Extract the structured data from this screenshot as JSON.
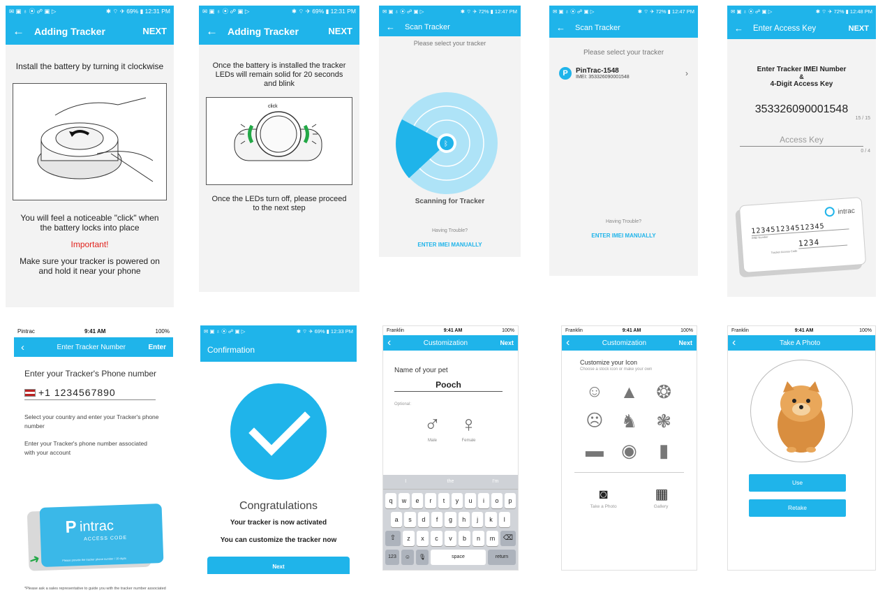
{
  "colors": {
    "accent": "#1fb4ea",
    "important": "#e0201a",
    "green": "#22a846"
  },
  "s1": {
    "status_left": "✉ ▣ ♁ ⦿ ☍ ▣ ▷",
    "status_right": "✱ ⌔ ✈ 69% ▮ 12:31 PM",
    "title": "Adding Tracker",
    "next": "NEXT",
    "instruction": "Install the battery by turning it clockwise",
    "click_text": "You will feel a noticeable \"click\" when the battery locks into place",
    "important": "Important!",
    "power_text": "Make sure your tracker is powered on and hold it near your phone"
  },
  "s2": {
    "status_left": "✉ ▣ ♁ ⦿ ☍ ▣ ▷",
    "status_right": "✱ ⌔ ✈ 69% ▮ 12:31 PM",
    "title": "Adding Tracker",
    "next": "NEXT",
    "instruction": "Once the battery is installed the tracker LEDs will remain solid for 20 seconds and blink",
    "click_label": "click",
    "after_text": "Once the LEDs turn off, please proceed to the next step"
  },
  "s3": {
    "status_left": "✉ ▣ ♁ ⦿ ☍ ▣ ▷",
    "status_right": "✱ ⌔ ✈ 72% ▮ 12:47 PM",
    "title": "Scan Tracker",
    "prompt": "Please select your tracker",
    "scanning": "Scanning for Tracker",
    "trouble": "Having Trouble?",
    "manual": "ENTER IMEI MANUALLY"
  },
  "s4": {
    "status_left": "✉ ▣ ♁ ⦿ ☍ ▣ ▷",
    "status_right": "✱ ⌔ ✈ 72% ▮ 12:47 PM",
    "title": "Scan Tracker",
    "prompt": "Please select your tracker",
    "tracker_name": "PinTrac-1548",
    "tracker_imei": "IMEI: 353326090001548",
    "trouble": "Having Trouble?",
    "manual": "ENTER IMEI MANUALLY"
  },
  "s5": {
    "status_left": "✉ ▣ ♁ ⦿ ☍ ▣ ▷",
    "status_right": "✱ ⌔ ✈ 72% ▮ 12:48 PM",
    "title": "Enter Access Key",
    "next": "NEXT",
    "heading1": "Enter Tracker IMEI Number",
    "amp": "&",
    "heading2": "4-Digit Access Key",
    "imei": "353326090001548",
    "imei_count": "15 / 15",
    "access_placeholder": "Access Key",
    "access_count": "0 / 4",
    "card_brand": "intrac",
    "card_imei": "123451234512345",
    "card_imei_label": "IMEI Number",
    "card_key": "1234",
    "card_key_label": "Tracker Access Code"
  },
  "s6": {
    "carrier": "Pintrac",
    "time": "9:41 AM",
    "battery": "100%",
    "title": "Enter Tracker Number",
    "action": "Enter",
    "heading": "Enter your Tracker's Phone number",
    "phone": "+1 1234567890",
    "text1": "Select your country and enter your Tracker's phone number",
    "text2": "Enter your Tracker's phone number associated with your account",
    "card_brand": "intrac",
    "card_sub": "ACCESS CODE",
    "card_footer": "Please provide the tracker phone number / 10 digits",
    "footnote": "*Please ask a sales representative to guide you with the tracker number associated with your account."
  },
  "s7": {
    "status_left": "✉ ▣ ♁ ⦿ ☍ ▣ ▷",
    "status_right": "✱ ⌔ ✈ 69% ▮ 12:33 PM",
    "title": "Confirmation",
    "congrats": "Congratulations",
    "activated": "Your tracker is now activated",
    "customize": "You can customize the tracker now",
    "next": "Next"
  },
  "s8": {
    "carrier": "Franklin",
    "time": "9:41 AM",
    "battery": "100%",
    "title": "Customization",
    "next": "Next",
    "name_label": "Name of your pet",
    "name_value": "Pooch",
    "optional": "Optional:",
    "male": "Male",
    "female": "Female",
    "suggestions": [
      "I",
      "the",
      "I'm"
    ],
    "row1": [
      "q",
      "w",
      "e",
      "r",
      "t",
      "y",
      "u",
      "i",
      "o",
      "p"
    ],
    "row2": [
      "a",
      "s",
      "d",
      "f",
      "g",
      "h",
      "j",
      "k",
      "l"
    ],
    "row3": [
      "z",
      "x",
      "c",
      "v",
      "b",
      "n",
      "m"
    ],
    "key_123": "123",
    "key_space": "space",
    "key_return": "return"
  },
  "s9": {
    "carrier": "Franklin",
    "time": "9:41 AM",
    "battery": "100%",
    "title": "Customization",
    "next": "Next",
    "heading": "Customize your Icon",
    "sub": "Choose a stock icon or make your own",
    "take_photo": "Take a Photo",
    "gallery": "Gallery"
  },
  "s10": {
    "carrier": "Franklin",
    "time": "9:41 AM",
    "battery": "100%",
    "title": "Take A Photo",
    "use": "Use",
    "retake": "Retake"
  }
}
